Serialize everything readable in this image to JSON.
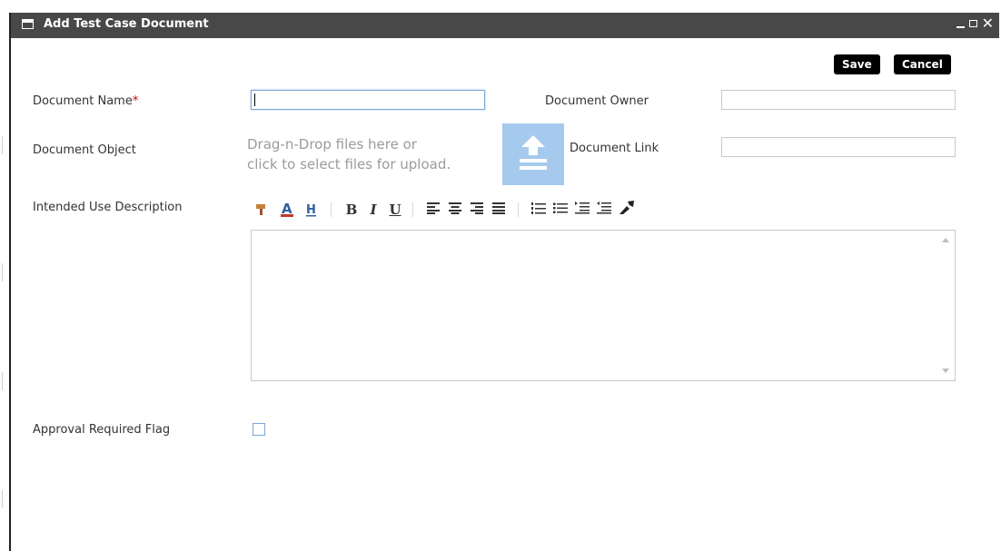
{
  "dialog": {
    "title": "Add Test Case Document",
    "controls": {
      "minimize": "minimize-icon",
      "maximize": "maximize-icon",
      "close": "close-icon"
    }
  },
  "actions": {
    "save_label": "Save",
    "cancel_label": "Cancel"
  },
  "form": {
    "document_name": {
      "label": "Document Name",
      "required_mark": "*",
      "value": ""
    },
    "document_owner": {
      "label": "Document Owner",
      "value": ""
    },
    "document_object": {
      "label": "Document Object",
      "drop_line1": "Drag-n-Drop files here or",
      "drop_line2": "click to select files for upload."
    },
    "document_link": {
      "label": "Document Link",
      "value": ""
    },
    "intended_use": {
      "label": "Intended Use Description",
      "value": ""
    },
    "approval_flag": {
      "label": "Approval Required Flag",
      "checked": false
    }
  },
  "editor_toolbar": [
    "paint-format-icon",
    "font-color-icon",
    "highlight-icon",
    "bold-icon",
    "italic-icon",
    "underline-icon",
    "align-left-icon",
    "align-center-icon",
    "align-right-icon",
    "justify-icon",
    "ordered-list-icon",
    "unordered-list-icon",
    "indent-icon",
    "outdent-icon",
    "clear-format-icon"
  ],
  "colors": {
    "titlebar": "#484848",
    "upload_bg": "#a6c9ee",
    "required": "#cc0000",
    "focus_border": "#7ea6d6"
  }
}
